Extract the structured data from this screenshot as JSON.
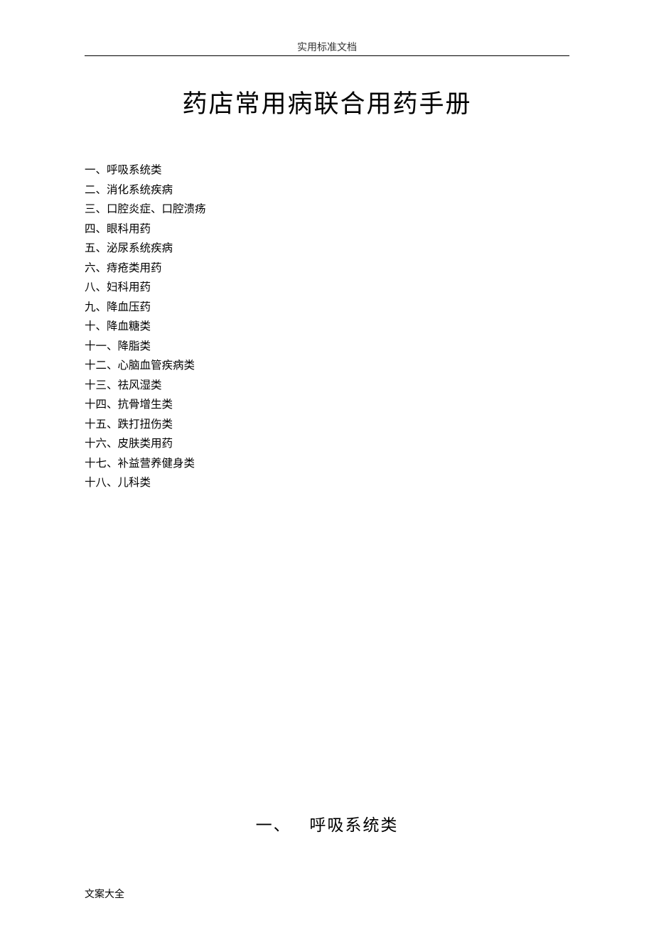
{
  "header": {
    "label": "实用标准文档"
  },
  "title": "药店常用病联合用药手册",
  "toc": {
    "items": [
      "一、呼吸系统类",
      "二、消化系统疾病",
      "三、口腔炎症、口腔溃疡",
      "四、眼科用药",
      "五、泌尿系统疾病",
      "六、痔疮类用药",
      "八、妇科用药",
      "九、降血压药",
      "十、降血糖类",
      "十一、降脂类",
      "十二、心脑血管疾病类",
      "十三、祛风湿类",
      "十四、抗骨增生类",
      "十五、跌打扭伤类",
      "十六、皮肤类用药",
      "十七、补益营养健身类",
      "十八、儿科类"
    ]
  },
  "section": {
    "number": "一、",
    "title": "呼吸系统类"
  },
  "footer": {
    "label": "文案大全"
  }
}
